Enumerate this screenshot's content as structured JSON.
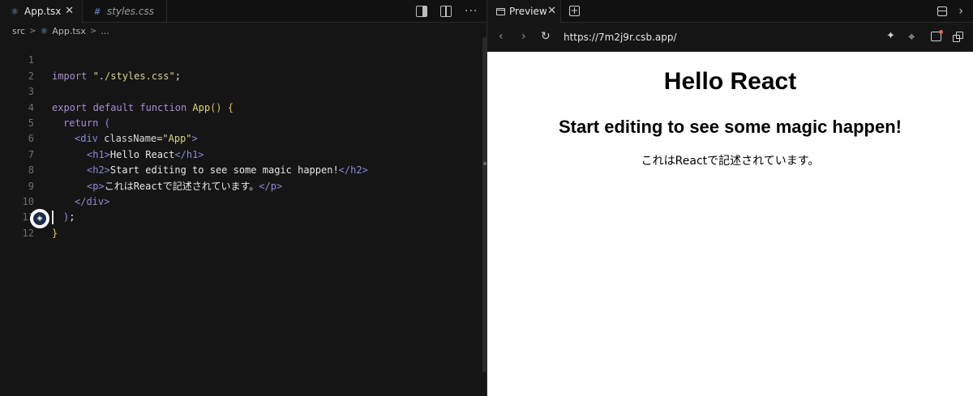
{
  "editor": {
    "tabs": [
      {
        "label": "App.tsx",
        "icon": "react-icon",
        "active": true
      },
      {
        "label": "styles.css",
        "icon": "hash-icon",
        "active": false
      }
    ],
    "icons": {
      "react": "⚛",
      "hash": "#",
      "close": "✕",
      "more": "···",
      "avatar": "◈"
    },
    "breadcrumb": {
      "folder": "src",
      "file": "App.tsx",
      "tail": "...",
      "sep": ">"
    },
    "lines": [
      {
        "n": "1"
      },
      {
        "n": "2"
      },
      {
        "n": "3"
      },
      {
        "n": "4"
      },
      {
        "n": "5"
      },
      {
        "n": "6"
      },
      {
        "n": "7"
      },
      {
        "n": "8"
      },
      {
        "n": "9"
      },
      {
        "n": "10"
      },
      {
        "n": "11"
      },
      {
        "n": "12"
      }
    ],
    "code": {
      "l1_kw": "import",
      "l1_str": " \"./styles.css\"",
      "l1_end": ";",
      "l3_kw": "export default function",
      "l3_fn": " App",
      "l3_paren": "()",
      "l3_brace": " {",
      "l4_kw": "return",
      "l4_paren": " (",
      "l5_tag_open": "<div",
      "l5_attr": " className",
      "l5_eq": "=",
      "l5_str": "\"App\"",
      "l5_tag_close": ">",
      "l6_tag_open": "<h1>",
      "l6_text": "Hello React",
      "l6_tag_close": "</h1>",
      "l7_tag_open": "<h2>",
      "l7_text": "Start editing to see some magic happen!",
      "l7_tag_close": "</h2>",
      "l8_tag_open": "<p>",
      "l8_text": "これはReactで記述されています。",
      "l8_tag_close": "</p>",
      "l9_tag": "</div>",
      "l10_paren": ")",
      "l10_end": ";",
      "l11_brace": "}"
    }
  },
  "preview": {
    "tab_label": "Preview",
    "add_tab": "+",
    "url": "https://7m2j9r.csb.app/",
    "nav": {
      "back": "‹",
      "forward": "›",
      "reload": "↻"
    },
    "tools": {
      "magic": "✦",
      "inspect": "⌖",
      "chevron": "›"
    },
    "page": {
      "h1": "Hello React",
      "h2": "Start editing to see some magic happen!",
      "p": "これはReactで記述されています。"
    }
  }
}
